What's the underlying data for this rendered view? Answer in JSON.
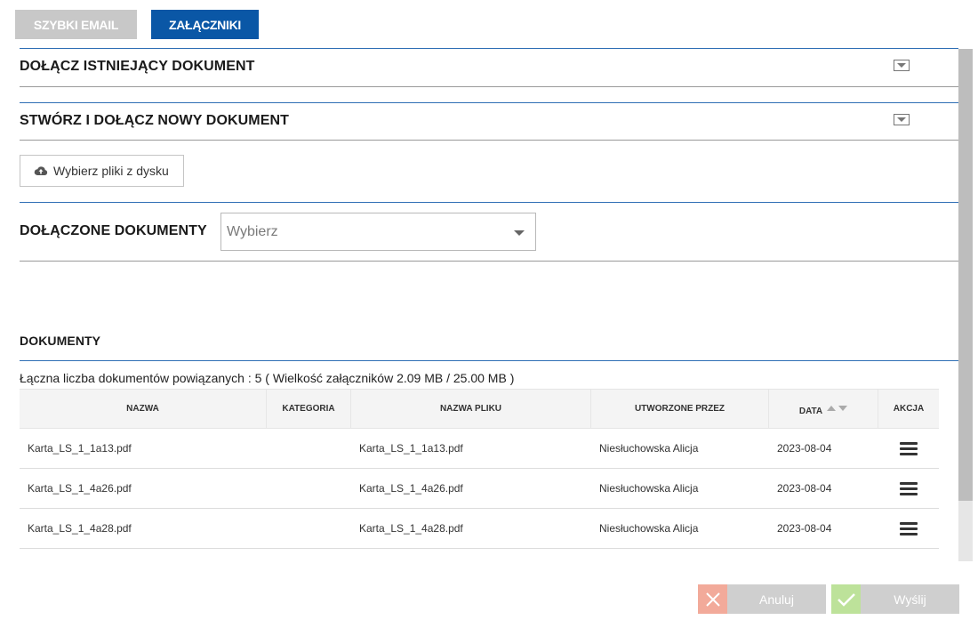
{
  "tabs": {
    "quick_email": "SZYBKI EMAIL",
    "attachments": "ZAŁĄCZNIKI"
  },
  "sections": {
    "attach_existing": "DOŁĄCZ ISTNIEJĄCY DOKUMENT",
    "create_new": "STWÓRZ I DOŁĄCZ NOWY DOKUMENT",
    "attached_docs": "DOŁĄCZONE DOKUMENTY",
    "documents": "DOKUMENTY"
  },
  "upload": {
    "label": "Wybierz pliki z dysku",
    "icon": "cloud-upload-icon"
  },
  "attached_select": {
    "placeholder": "Wybierz"
  },
  "summary": "Łączna liczba dokumentów powiązanych : 5 ( Wielkość załączników 2.09 MB / 25.00 MB )",
  "table": {
    "headers": {
      "name": "NAZWA",
      "category": "KATEGORIA",
      "file_name": "NAZWA PLIKU",
      "created_by": "UTWORZONE PRZEZ",
      "date": "DATA",
      "action": "AKCJA"
    },
    "rows": [
      {
        "name": "Karta_LS_1_1a13.pdf",
        "category": "",
        "file_name": "Karta_LS_1_1a13.pdf",
        "created_by": "Niesłuchowska Alicja",
        "date": "2023-08-04"
      },
      {
        "name": "Karta_LS_1_4a26.pdf",
        "category": "",
        "file_name": "Karta_LS_1_4a26.pdf",
        "created_by": "Niesłuchowska Alicja",
        "date": "2023-08-04"
      },
      {
        "name": "Karta_LS_1_4a28.pdf",
        "category": "",
        "file_name": "Karta_LS_1_4a28.pdf",
        "created_by": "Niesłuchowska Alicja",
        "date": "2023-08-04"
      }
    ]
  },
  "buttons": {
    "cancel": "Anuluj",
    "send": "Wyślij"
  },
  "colors": {
    "active_tab": "#0a57a6",
    "inactive_tab": "#c8c8c8",
    "section_line": "#2f6fb5",
    "cancel_icon_bg": "#f2aa9a",
    "send_icon_bg": "#bde29a"
  }
}
